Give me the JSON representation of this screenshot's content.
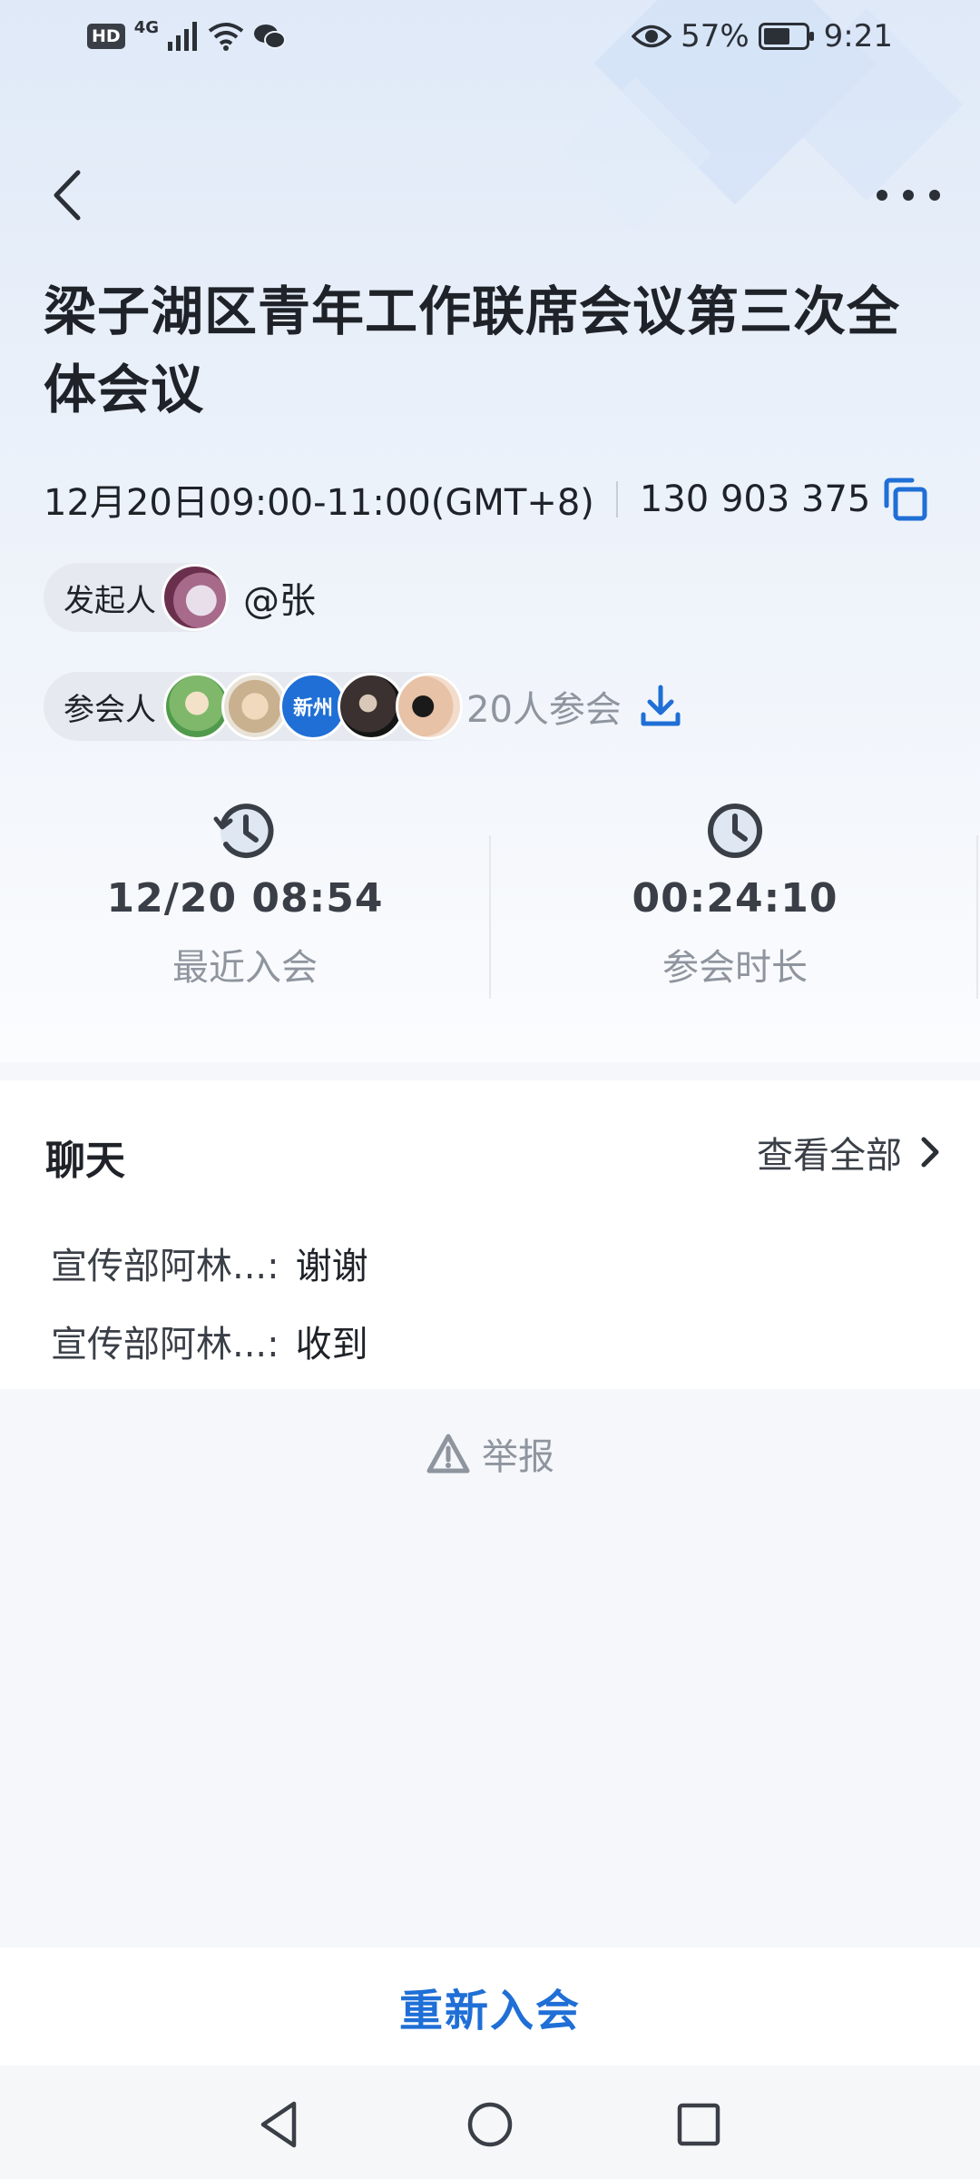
{
  "status_bar": {
    "hd": "HD",
    "network": "4G",
    "battery_percent": "57%",
    "battery_level": 0.57,
    "time": "9:21"
  },
  "meeting": {
    "title": "梁子湖区青年工作联席会议第三次全体会议",
    "time_range": "12月20日09:00-11:00(GMT+8)",
    "meeting_id": "130 903 375"
  },
  "host": {
    "chip_label": "发起人",
    "name": "@张"
  },
  "attendees": {
    "chip_label": "参会人",
    "avatar_text": "新州",
    "count_text": "20人参会"
  },
  "stats": [
    {
      "value": "12/20 08:54",
      "label": "最近入会",
      "icon": "history-clock-icon"
    },
    {
      "value": "00:24:10",
      "label": "参会时长",
      "icon": "clock-icon"
    }
  ],
  "chat": {
    "title": "聊天",
    "view_all": "查看全部",
    "messages": [
      {
        "sender": "宣传部阿林...:",
        "text": "谢谢"
      },
      {
        "sender": "宣传部阿林...:",
        "text": "收到"
      }
    ]
  },
  "report": {
    "label": "举报"
  },
  "rejoin_button": "重新入会",
  "colors": {
    "accent": "#1f6fd6",
    "text_primary": "#1f2329",
    "text_secondary": "#8f959e",
    "chip_bg": "#e6eaf0"
  }
}
